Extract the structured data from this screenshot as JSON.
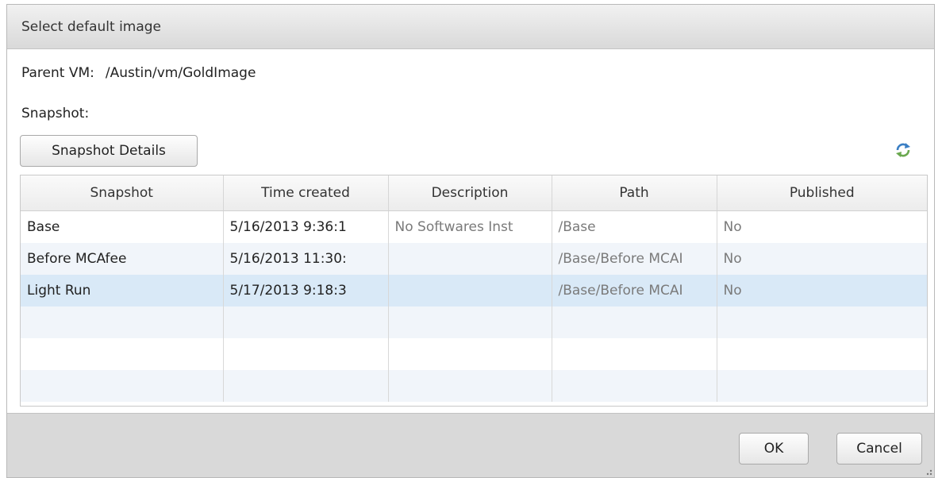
{
  "dialog": {
    "title": "Select default image",
    "parent_vm_label": "Parent VM:",
    "parent_vm_value": "/Austin/vm/GoldImage",
    "snapshot_label": "Snapshot:",
    "details_button": "Snapshot Details",
    "refresh_icon": "refresh-icon"
  },
  "table": {
    "columns": [
      "Snapshot",
      "Time created",
      "Description",
      "Path",
      "Published"
    ],
    "rows": [
      {
        "snapshot": "Base",
        "time": "5/16/2013 9:36:1",
        "description": "No Softwares Inst",
        "path": "/Base",
        "published": "No"
      },
      {
        "snapshot": "Before MCAfee",
        "time": "5/16/2013 11:30:",
        "description": "",
        "path": "/Base/Before MCAI",
        "published": "No"
      },
      {
        "snapshot": "Light Run",
        "time": "5/17/2013 9:18:3",
        "description": "",
        "path": "/Base/Before MCAI",
        "published": "No",
        "selected": true
      }
    ]
  },
  "footer": {
    "ok_button": "OK",
    "cancel_button": "Cancel"
  },
  "colors": {
    "selected_row": "#d9e9f7",
    "alt_row": "#f1f5fa",
    "footer_bg": "#d9d9d9"
  }
}
